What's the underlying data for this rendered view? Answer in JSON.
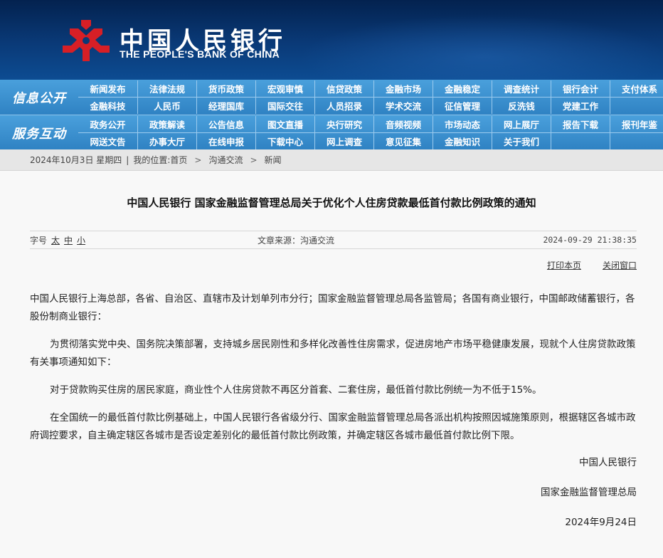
{
  "header": {
    "name_cn": "中国人民银行",
    "name_en": "THE PEOPLE'S BANK OF CHINA",
    "logo_icon": "pboc-emblem-icon",
    "brand_color": "#d71f26"
  },
  "nav": {
    "groups": [
      {
        "label": "信息公开",
        "rows": [
          [
            "新闻发布",
            "法律法规",
            "货币政策",
            "宏观审慎",
            "信贷政策",
            "金融市场",
            "金融稳定",
            "调查统计",
            "银行会计",
            "支付体系"
          ],
          [
            "金融科技",
            "人民币",
            "经理国库",
            "国际交往",
            "人员招录",
            "学术交流",
            "征信管理",
            "反洗钱",
            "党建工作",
            ""
          ]
        ]
      },
      {
        "label": "服务互动",
        "rows": [
          [
            "政务公开",
            "政策解读",
            "公告信息",
            "图文直播",
            "央行研究",
            "音频视频",
            "市场动态",
            "网上展厅",
            "报告下载",
            "报刊年鉴"
          ],
          [
            "网送文告",
            "办事大厅",
            "在线申报",
            "下载中心",
            "网上调查",
            "意见征集",
            "金融知识",
            "关于我们",
            "",
            ""
          ]
        ]
      }
    ]
  },
  "breadcrumb": {
    "date": "2024年10月3日 星期四",
    "location_label": "我的位置:",
    "items": [
      "首页",
      "沟通交流",
      "新闻"
    ],
    "separator": ">"
  },
  "article": {
    "title": "中国人民银行  国家金融监督管理总局关于优化个人住房贷款最低首付款比例政策的通知",
    "font_size_label": "字号",
    "font_sizes": [
      "太",
      "中",
      "小"
    ],
    "source": "文章来源：沟通交流",
    "timestamp": "2024-09-29  21:38:35",
    "print_label": "打印本页",
    "close_label": "关闭窗口",
    "paragraphs": [
      "中国人民银行上海总部，各省、自治区、直辖市及计划单列市分行；国家金融监督管理总局各监管局；各国有商业银行，中国邮政储蓄银行，各股份制商业银行：",
      "为贯彻落实党中央、国务院决策部署，支持城乡居民刚性和多样化改善性住房需求，促进房地产市场平稳健康发展，现就个人住房贷款政策有关事项通知如下：",
      "对于贷款购买住房的居民家庭，商业性个人住房贷款不再区分首套、二套住房，最低首付款比例统一为不低于15%。",
      "在全国统一的最低首付款比例基础上，中国人民银行各省级分行、国家金融监督管理总局各派出机构按照因城施策原则，根据辖区各城市政府调控要求，自主确定辖区各城市是否设定差别化的最低首付款比例政策，并确定辖区各城市最低首付款比例下限。"
    ],
    "signatures": [
      "中国人民银行",
      "国家金融监督管理总局",
      "2024年9月24日"
    ]
  }
}
